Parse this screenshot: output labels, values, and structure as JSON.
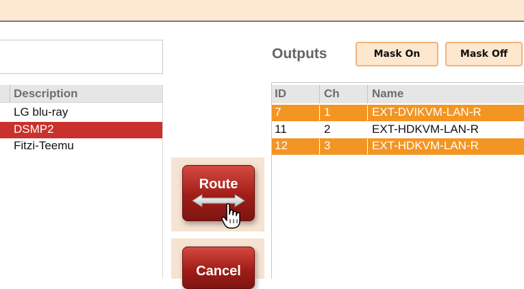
{
  "inputs": {
    "header": {
      "description": "Description"
    },
    "rows": [
      {
        "description": "LG blu-ray"
      },
      {
        "description": "DSMP2"
      },
      {
        "description": "Fitzi-Teemu"
      }
    ]
  },
  "actions": {
    "route_label": "Route",
    "cancel_label": "Cancel"
  },
  "outputs": {
    "title": "Outputs",
    "mask_on_label": "Mask On",
    "mask_off_label": "Mask Off",
    "header": {
      "id": "ID",
      "ch": "Ch",
      "name": "Name"
    },
    "rows": [
      {
        "id": "7",
        "ch": "1",
        "name": "EXT-DVIKVM-LAN-R"
      },
      {
        "id": "11",
        "ch": "2",
        "name": "EXT-HDKVM-LAN-R"
      },
      {
        "id": "12",
        "ch": "3",
        "name": "EXT-HDKVM-LAN-R"
      }
    ]
  },
  "colors": {
    "selected_input": "#c8312c",
    "highlighted_output": "#f39523",
    "button_red": "#a11d18",
    "top_bar": "#fde8d2"
  },
  "icons": {
    "route": "double-arrow-icon",
    "cursor": "hand-pointer-icon"
  }
}
